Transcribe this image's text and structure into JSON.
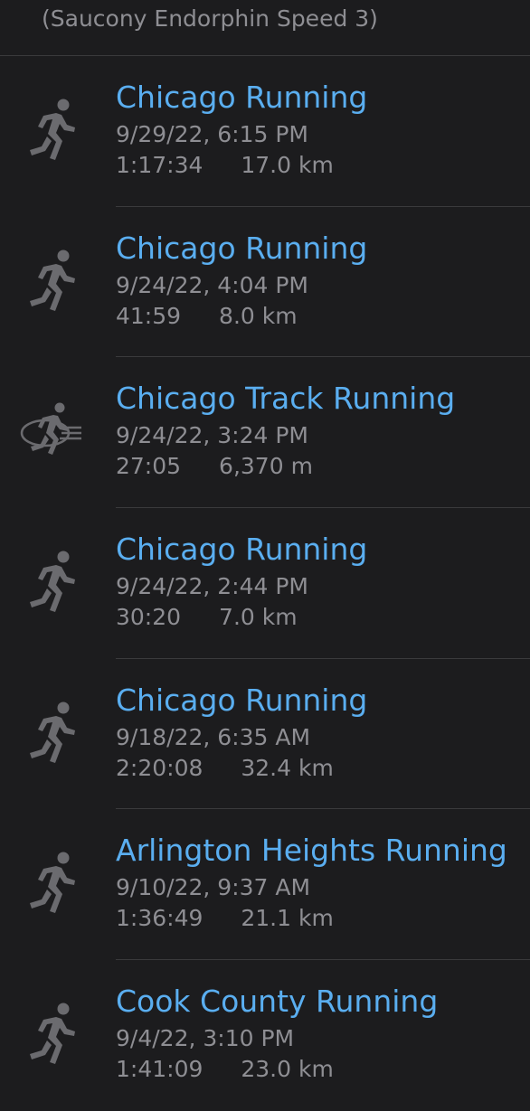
{
  "header": {
    "text": "(Saucony Endorphin Speed 3)"
  },
  "colors": {
    "background": "#1c1c1e",
    "title": "#5aaef0",
    "secondary": "#8e8e93",
    "divider": "#3a3a3c"
  },
  "workouts": [
    {
      "title": "Chicago Running",
      "date": "9/29/22, 6:15 PM",
      "duration": "1:17:34",
      "distance": "17.0 km",
      "icon": "running-icon"
    },
    {
      "title": "Chicago Running",
      "date": "9/24/22, 4:04 PM",
      "duration": "41:59",
      "distance": "8.0 km",
      "icon": "running-icon"
    },
    {
      "title": "Chicago Track Running",
      "date": "9/24/22, 3:24 PM",
      "duration": "27:05",
      "distance": "6,370 m",
      "icon": "track-running-icon"
    },
    {
      "title": "Chicago Running",
      "date": "9/24/22, 2:44 PM",
      "duration": "30:20",
      "distance": "7.0 km",
      "icon": "running-icon"
    },
    {
      "title": "Chicago Running",
      "date": "9/18/22, 6:35 AM",
      "duration": "2:20:08",
      "distance": "32.4 km",
      "icon": "running-icon"
    },
    {
      "title": "Arlington Heights Running",
      "date": "9/10/22, 9:37 AM",
      "duration": "1:36:49",
      "distance": "21.1 km",
      "icon": "running-icon"
    },
    {
      "title": "Cook County Running",
      "date": "9/4/22, 3:10 PM",
      "duration": "1:41:09",
      "distance": "23.0 km",
      "icon": "running-icon"
    }
  ]
}
